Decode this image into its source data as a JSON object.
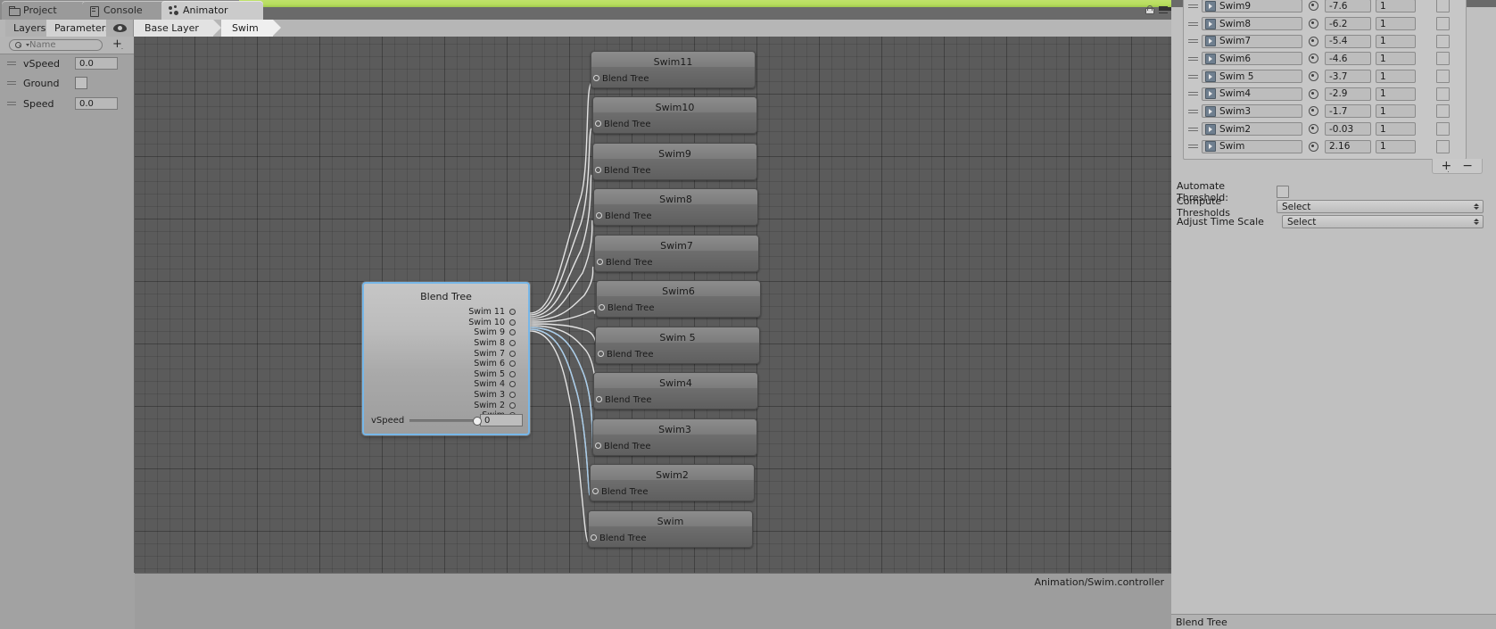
{
  "window_tabs": [
    {
      "label": "Project",
      "icon": "folder-icon",
      "active": false
    },
    {
      "label": "Console",
      "icon": "console-icon",
      "active": false
    },
    {
      "label": "Animator",
      "icon": "animator-icon",
      "active": true
    }
  ],
  "subbar": {
    "minitabs": [
      {
        "label": "Layers",
        "selected": false
      },
      {
        "label": "Parameters",
        "selected": true
      }
    ],
    "eye_icon": "eye-icon",
    "breadcrumbs": [
      {
        "label": "Base Layer"
      },
      {
        "label": "Swim"
      }
    ]
  },
  "parameters_panel": {
    "search_placeholder": "Name",
    "add_label": "+",
    "rows": [
      {
        "name": "vSpeed",
        "type": "float",
        "value": "0.0"
      },
      {
        "name": "Ground",
        "type": "bool",
        "value": ""
      },
      {
        "name": "Speed",
        "type": "float",
        "value": "0.0"
      }
    ]
  },
  "graph": {
    "blend_tree_node": {
      "title": "Blend Tree",
      "ports": [
        "Swim 11",
        "Swim 10",
        "Swim 9",
        "Swim 8",
        "Swim 7",
        "Swim 6",
        "Swim 5",
        "Swim 4",
        "Swim 3",
        "Swim 2",
        "Swim"
      ],
      "slider_label": "vSpeed",
      "slider_value": "0",
      "slider_position_pct": 97,
      "selected_outline_color": "#77b7e8"
    },
    "state_nodes": [
      {
        "title": "Swim11",
        "subtitle": "Blend Tree"
      },
      {
        "title": "Swim10",
        "subtitle": "Blend Tree"
      },
      {
        "title": "Swim9",
        "subtitle": "Blend Tree"
      },
      {
        "title": "Swim8",
        "subtitle": "Blend Tree"
      },
      {
        "title": "Swim7",
        "subtitle": "Blend Tree"
      },
      {
        "title": "Swim6",
        "subtitle": "Blend Tree"
      },
      {
        "title": "Swim 5",
        "subtitle": "Blend Tree"
      },
      {
        "title": "Swim4",
        "subtitle": "Blend Tree"
      },
      {
        "title": "Swim3",
        "subtitle": "Blend Tree"
      },
      {
        "title": "Swim2",
        "subtitle": "Blend Tree"
      },
      {
        "title": "Swim",
        "subtitle": "Blend Tree"
      }
    ],
    "status_text": "Animation/Swim.controller"
  },
  "inspector": {
    "motion_rows": [
      {
        "motion": "Swim9",
        "threshold": "-7.6",
        "time_scale": "1",
        "mirror": false
      },
      {
        "motion": "Swim8",
        "threshold": "-6.2",
        "time_scale": "1",
        "mirror": false
      },
      {
        "motion": "Swim7",
        "threshold": "-5.4",
        "time_scale": "1",
        "mirror": false
      },
      {
        "motion": "Swim6",
        "threshold": "-4.6",
        "time_scale": "1",
        "mirror": false
      },
      {
        "motion": "Swim 5",
        "threshold": "-3.7",
        "time_scale": "1",
        "mirror": false
      },
      {
        "motion": "Swim4",
        "threshold": "-2.9",
        "time_scale": "1",
        "mirror": false
      },
      {
        "motion": "Swim3",
        "threshold": "-1.7",
        "time_scale": "1",
        "mirror": false
      },
      {
        "motion": "Swim2",
        "threshold": "-0.03",
        "time_scale": "1",
        "mirror": false
      },
      {
        "motion": "Swim",
        "threshold": "2.16",
        "time_scale": "1",
        "mirror": false
      }
    ],
    "add_button": "+",
    "remove_button": "−",
    "fields": [
      {
        "label": "Automate Threshold:",
        "control": "checkbox",
        "value": ""
      },
      {
        "label": "Compute Thresholds",
        "control": "popup",
        "value": "Select"
      },
      {
        "label": "Adjust Time Scale",
        "control": "popup",
        "value": "Select"
      }
    ],
    "status_text": "Blend Tree"
  }
}
